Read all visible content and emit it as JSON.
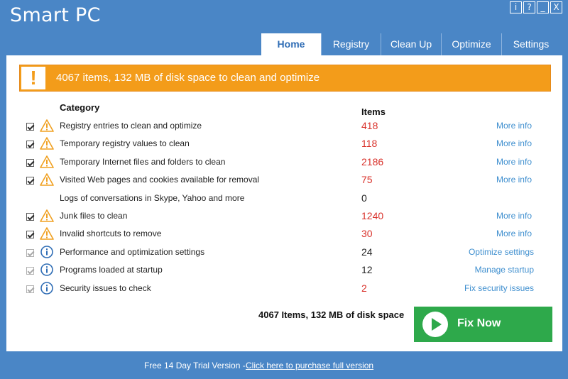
{
  "app": {
    "title": "Smart PC"
  },
  "window_controls": [
    "i",
    "?",
    "_",
    "X"
  ],
  "tabs": [
    {
      "label": "Home",
      "active": true
    },
    {
      "label": "Registry",
      "active": false
    },
    {
      "label": "Clean Up",
      "active": false
    },
    {
      "label": "Optimize",
      "active": false
    },
    {
      "label": "Settings",
      "active": false
    }
  ],
  "banner": {
    "icon": "!",
    "text": "4067 items, 132 MB of disk space to clean and optimize"
  },
  "table": {
    "header_category": "Category",
    "header_items": "Items"
  },
  "rows": [
    {
      "checkbox": true,
      "icon": "warning-icon",
      "label": "Registry entries to clean and optimize",
      "count": "418",
      "count_color": "red",
      "link": "More info"
    },
    {
      "checkbox": true,
      "icon": "warning-icon",
      "label": "Temporary registry values to clean",
      "count": "118",
      "count_color": "red",
      "link": "More info"
    },
    {
      "checkbox": true,
      "icon": "warning-icon",
      "label": "Temporary Internet files and folders to clean",
      "count": "2186",
      "count_color": "red",
      "link": "More info"
    },
    {
      "checkbox": true,
      "icon": "warning-icon",
      "label": "Visited Web pages and cookies available for removal",
      "count": "75",
      "count_color": "red",
      "link": "More info"
    },
    {
      "checkbox": false,
      "icon": "",
      "label": "Logs of conversations in Skype, Yahoo and more",
      "count": "0",
      "count_color": "black",
      "link": ""
    },
    {
      "checkbox": true,
      "icon": "warning-icon",
      "label": "Junk files to clean",
      "count": "1240",
      "count_color": "red",
      "link": "More info"
    },
    {
      "checkbox": true,
      "icon": "warning-icon",
      "label": "Invalid shortcuts to remove",
      "count": "30",
      "count_color": "red",
      "link": "More info"
    },
    {
      "checkbox": "disabled",
      "icon": "info-icon",
      "label": "Performance and optimization settings",
      "count": "24",
      "count_color": "black",
      "link": "Optimize settings"
    },
    {
      "checkbox": "disabled",
      "icon": "info-icon",
      "label": "Programs loaded at startup",
      "count": "12",
      "count_color": "black",
      "link": "Manage startup"
    },
    {
      "checkbox": "disabled",
      "icon": "info-icon",
      "label": "Security issues to check",
      "count": "2",
      "count_color": "red",
      "link": "Fix security issues"
    }
  ],
  "summary": "4067 Items, 132 MB of disk space",
  "fix_button": {
    "label": "Fix Now"
  },
  "footer": {
    "trial_text": "Free 14 Day Trial Version -",
    "purchase_link": "Click here to purchase full version"
  },
  "colors": {
    "chrome_blue": "#4a86c6",
    "banner_orange": "#f39c1a",
    "fix_green": "#2ea94b",
    "count_red": "#d9322b",
    "link_blue": "#3f8fcf"
  }
}
